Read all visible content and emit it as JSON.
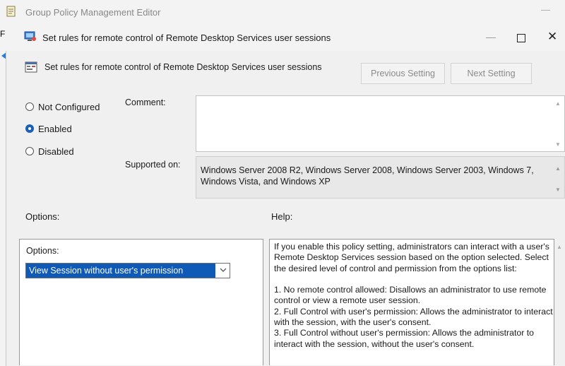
{
  "background_window": {
    "title": "Group Policy Management Editor",
    "menu_fragment": "Fi",
    "minimize_glyph": "—"
  },
  "dialog": {
    "title": "Set rules for remote control of Remote Desktop Services user sessions",
    "minimize_glyph": "—",
    "close_glyph": "✕",
    "header_title": "Set rules for remote control of Remote Desktop Services user sessions",
    "previous_button": "Previous Setting",
    "next_button": "Next Setting"
  },
  "state": {
    "radios": [
      {
        "label": "Not Configured",
        "selected": false
      },
      {
        "label": "Enabled",
        "selected": true
      },
      {
        "label": "Disabled",
        "selected": false
      }
    ],
    "comment_label": "Comment:",
    "comment_value": "",
    "supported_label": "Supported on:",
    "supported_value": "Windows Server 2008 R2, Windows Server 2008, Windows Server 2003, Windows 7, Windows Vista, and Windows XP"
  },
  "options": {
    "section_label": "Options:",
    "inner_label": "Options:",
    "selected_value": "View Session without user's permission"
  },
  "help": {
    "section_label": "Help:",
    "text": "If you enable this policy setting, administrators can interact with a user's Remote Desktop Services session based on the option selected. Select the desired level of control and permission from the options list:\n\n1. No remote control allowed: Disallows an administrator to use remote control or view a remote user session.\n2. Full Control with user's permission: Allows the administrator to interact with the session, with the user's consent.\n3. Full Control without user's permission: Allows the administrator to interact with the session, without the user's consent."
  },
  "colors": {
    "accent": "#0f5ab6",
    "window_bg": "#f0f0f0",
    "disabled_text": "#8b8b8b"
  },
  "icons": {
    "app_icon": "policy-editor-icon",
    "dialog_icon": "remote-desktop-icon",
    "setting_icon": "policy-setting-icon",
    "scroll_up": "▲",
    "scroll_down": "▼"
  }
}
